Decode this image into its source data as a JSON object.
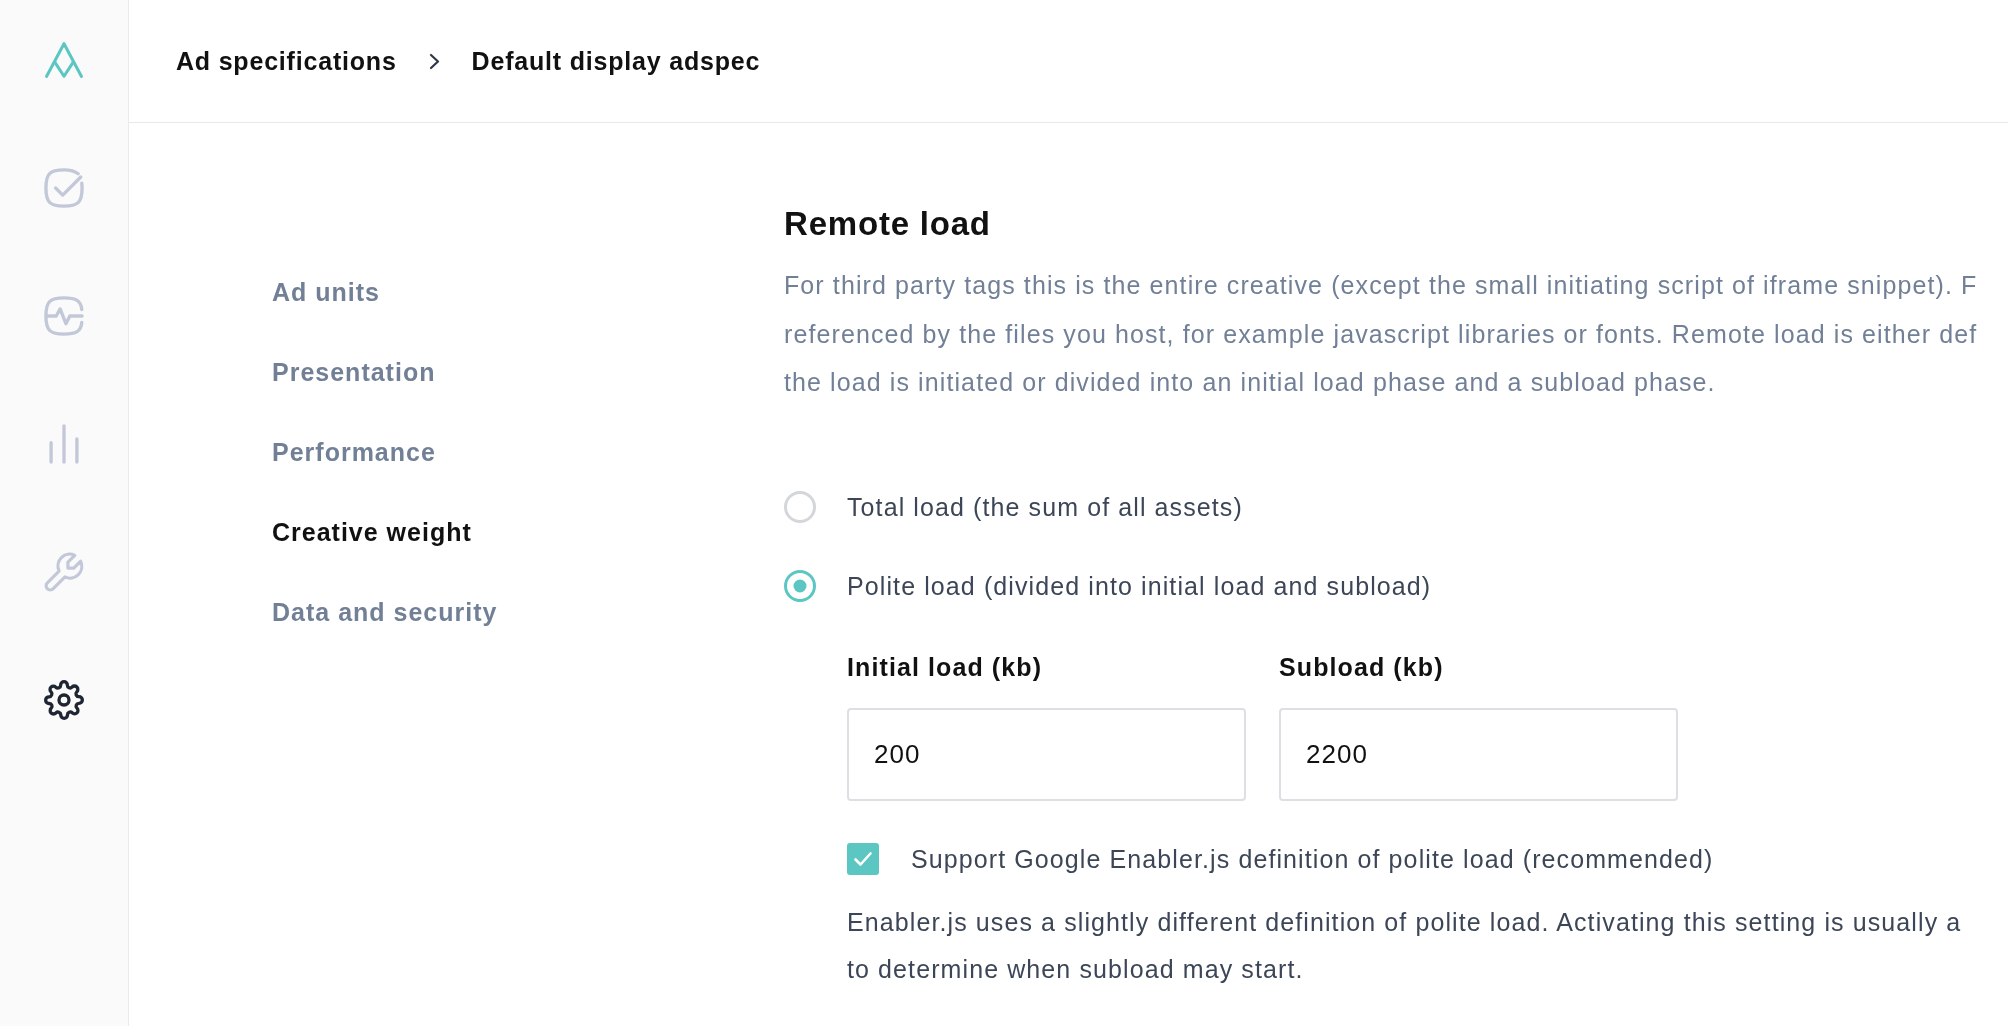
{
  "sidebar": {
    "items": [
      {
        "selected": false
      },
      {
        "selected": false
      },
      {
        "selected": false
      },
      {
        "selected": false
      },
      {
        "selected": true
      }
    ]
  },
  "breadcrumb": {
    "items": [
      "Ad specifications",
      "Default display adspec"
    ]
  },
  "section_nav": {
    "items": [
      {
        "label": "Ad units",
        "selected": false
      },
      {
        "label": "Presentation",
        "selected": false
      },
      {
        "label": "Performance",
        "selected": false
      },
      {
        "label": "Creative weight",
        "selected": true
      },
      {
        "label": "Data and security",
        "selected": false
      }
    ]
  },
  "remote_load": {
    "title": "Remote load",
    "description_lines": [
      "For third party tags this is the entire creative (except the small initiating script of iframe snippet). F",
      "referenced by the files you host, for example javascript libraries or fonts. Remote load is either def",
      "the load is initiated or divided into an initial load phase and a subload phase."
    ],
    "options": [
      {
        "label": "Total load (the sum of all assets)",
        "selected": false
      },
      {
        "label": "Polite load (divided into initial load and subload)",
        "selected": true
      }
    ],
    "fields": [
      {
        "label": "Initial load (kb)",
        "value": "200"
      },
      {
        "label": "Subload (kb)",
        "value": "2200"
      }
    ],
    "checkbox": {
      "label": "Support Google Enabler.js definition of polite load (recommended)",
      "checked": true
    },
    "help_lines": [
      "Enabler.js uses a slightly different definition of polite load. Activating this setting is usually a",
      "to determine when subload may start."
    ]
  }
}
